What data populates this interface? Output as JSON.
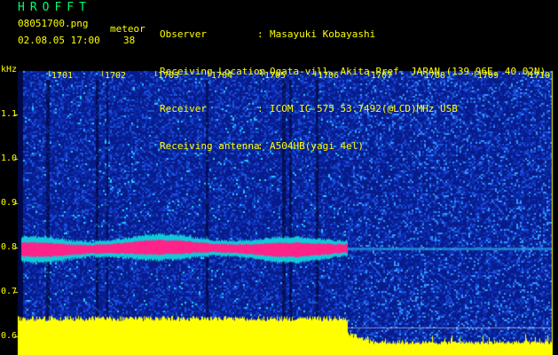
{
  "header": {
    "brand": "HROFFT",
    "filename": "08051700.png",
    "timestamp": "02.08.05 17:00",
    "meteor_label": "meteor",
    "meteor_count": "38",
    "meta": [
      {
        "key": "Observer",
        "value": "Masayuki Kobayashi"
      },
      {
        "key": "Receiving Location",
        "value": "Ogata-vill. Akita-Pref. JAPAN (139.96E, 40.02N)"
      },
      {
        "key": "Receiver",
        "value": "ICOM IC-575 53.7492(@LCD)MHz USB"
      },
      {
        "key": "Receiving antenna",
        "value": "A504HB(yagi 4el)"
      }
    ]
  },
  "axes": {
    "y_unit": "kHz",
    "y_ticks": [
      "1.1",
      "1.0",
      "0.9",
      "0.8",
      "0.7",
      "0.6"
    ],
    "x_ticks": [
      "1701",
      "1702",
      "1703",
      "1704",
      "1705",
      "1706",
      "1707",
      "1708",
      "1709",
      "1710"
    ]
  },
  "colors": {
    "text": "#ffff00",
    "brand": "#00ff66",
    "background_noise": "#0a1a8c",
    "echo_band": "#ff2288",
    "signal_floor": "#ffff00"
  }
}
